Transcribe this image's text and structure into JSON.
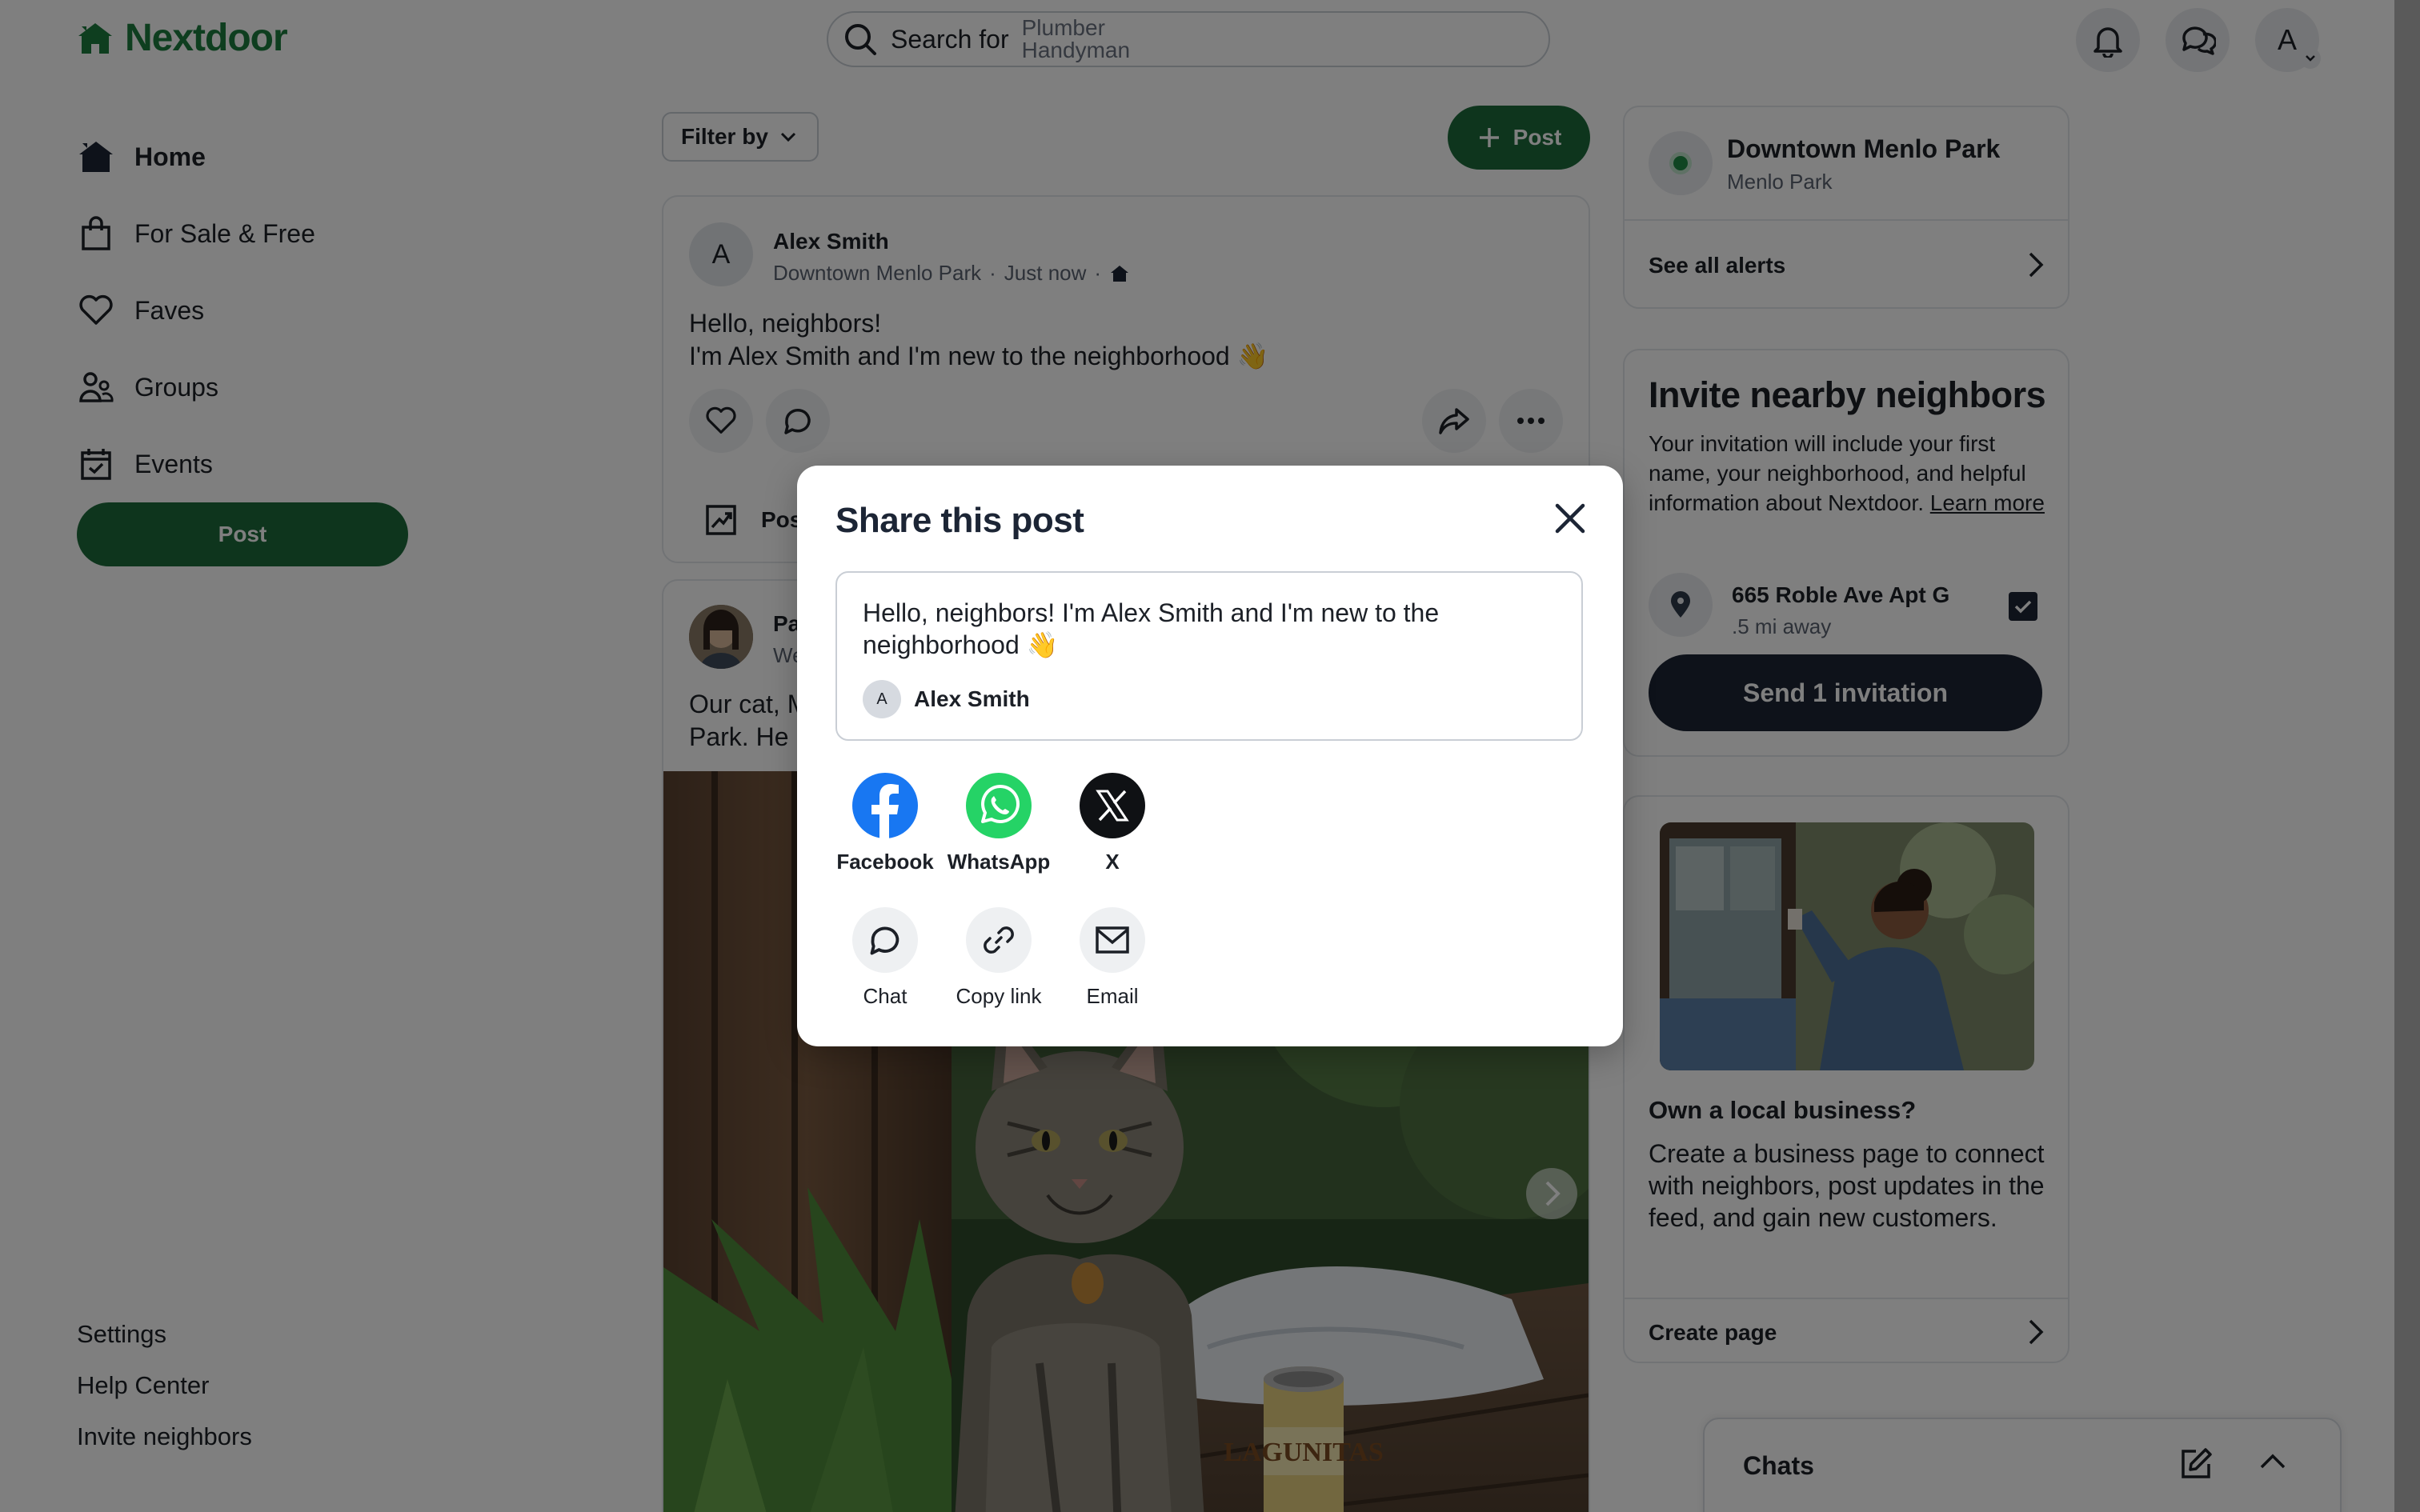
{
  "header": {
    "logo_text": "Nextdoor",
    "search_prefix": "Search for",
    "search_hints": [
      "Plumber",
      "Handyman"
    ],
    "avatar_initial": "A"
  },
  "nav": {
    "items": [
      {
        "label": "Home",
        "icon": "home-icon"
      },
      {
        "label": "For Sale & Free",
        "icon": "bag-icon"
      },
      {
        "label": "Faves",
        "icon": "heart-icon"
      },
      {
        "label": "Groups",
        "icon": "groups-icon"
      },
      {
        "label": "Events",
        "icon": "calendar-icon"
      }
    ],
    "post_button": "Post",
    "footer_links": [
      "Settings",
      "Help Center",
      "Invite neighbors"
    ]
  },
  "feed": {
    "filter_label": "Filter by",
    "post_button": "Post",
    "post1": {
      "avatar_initial": "A",
      "author": "Alex Smith",
      "neighborhood": "Downtown Menlo Park",
      "time": "Just now",
      "body_line1": "Hello, neighbors!",
      "body_line2": "I'm Alex Smith and I'm new to the neighborhood 👋",
      "footer_label": "Pos"
    },
    "post2": {
      "author_partial": "Pa",
      "meta_partial": "We",
      "body_line1": "Our cat, M",
      "body_line2": "Park. He is"
    }
  },
  "right": {
    "neighborhood": {
      "name": "Downtown Menlo Park",
      "city": "Menlo Park",
      "alerts_link": "See all alerts"
    },
    "invite": {
      "title": "Invite nearby neighbors",
      "text": "Your invitation will include your first name, your neighborhood, and helpful information about Nextdoor.",
      "learn_more": "Learn more",
      "address": "665 Roble Ave Apt G",
      "distance": ".5 mi away",
      "send_button": "Send 1 invitation"
    },
    "business": {
      "title": "Own a local business?",
      "text": "Create a business page to connect with neighbors, post updates in the feed, and gain new customers.",
      "link": "Create page"
    },
    "chats_title": "Chats"
  },
  "modal": {
    "title": "Share this post",
    "preview_text": "Hello, neighbors! I'm Alex Smith and I'm new to the neighborhood 👋",
    "preview_avatar": "A",
    "preview_author": "Alex Smith",
    "options": [
      {
        "label": "Facebook",
        "icon": "facebook-icon"
      },
      {
        "label": "WhatsApp",
        "icon": "whatsapp-icon"
      },
      {
        "label": "X",
        "icon": "x-icon"
      },
      {
        "label": "Chat",
        "icon": "chat-icon"
      },
      {
        "label": "Copy link",
        "icon": "link-icon"
      },
      {
        "label": "Email",
        "icon": "email-icon"
      }
    ]
  },
  "colors": {
    "brand_green": "#1d6a3b",
    "dark_navy": "#1c2535",
    "facebook_blue": "#1877f2",
    "whatsapp_green": "#25d366"
  }
}
